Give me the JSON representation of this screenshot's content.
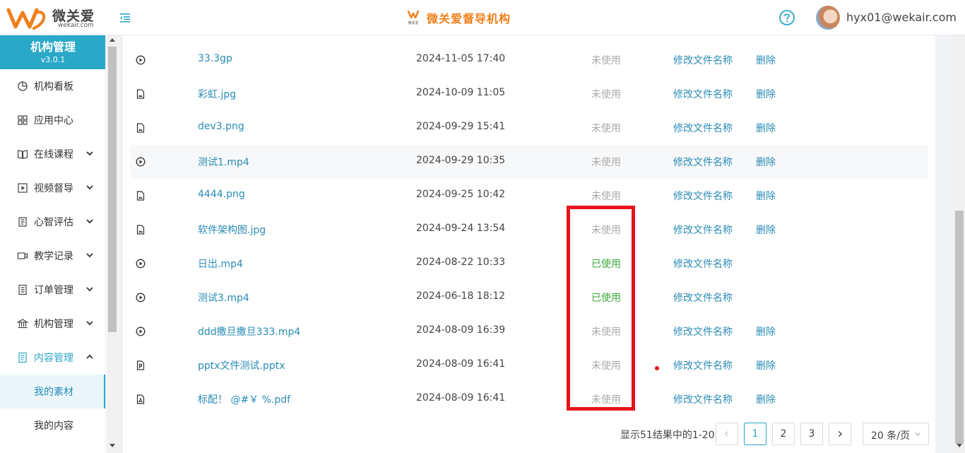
{
  "header": {
    "logo_cn": "微关爱",
    "logo_en": "wekair.com",
    "brand_icon_text": "微关爱",
    "brand_title": "微关爱督导机构",
    "user_email": "hyx01@wekair.com"
  },
  "sidebar": {
    "title": "机构管理",
    "version": "v3.0.1",
    "items": [
      {
        "label": "机构看板",
        "icon": "dashboard-icon"
      },
      {
        "label": "应用中心",
        "icon": "grid-icon"
      },
      {
        "label": "在线课程",
        "icon": "course-icon"
      },
      {
        "label": "视频督导",
        "icon": "video-icon"
      },
      {
        "label": "心智评估",
        "icon": "assessment-icon"
      },
      {
        "label": "教学记录",
        "icon": "camera-icon"
      },
      {
        "label": "订单管理",
        "icon": "order-icon"
      },
      {
        "label": "机构管理",
        "icon": "institution-icon"
      },
      {
        "label": "内容管理",
        "icon": "content-icon"
      }
    ],
    "sub_items": [
      {
        "label": "我的素材"
      },
      {
        "label": "我的内容"
      }
    ]
  },
  "table": {
    "rename_label": "修改文件名称",
    "delete_label": "删除",
    "rows": [
      {
        "type": "video",
        "name": "33.3gp",
        "date": "2024-11-05 17:40",
        "status": "未使用"
      },
      {
        "type": "image",
        "name": "彩虹.jpg",
        "date": "2024-10-09 11:05",
        "status": "未使用"
      },
      {
        "type": "image",
        "name": "dev3.png",
        "date": "2024-09-29 15:41",
        "status": "未使用"
      },
      {
        "type": "video",
        "name": "测试1.mp4",
        "date": "2024-09-29 10:35",
        "status": "未使用"
      },
      {
        "type": "image",
        "name": "4444.png",
        "date": "2024-09-25 10:42",
        "status": "未使用"
      },
      {
        "type": "image",
        "name": "软件架构图.jpg",
        "date": "2024-09-24 13:54",
        "status": "未使用"
      },
      {
        "type": "video",
        "name": "日出.mp4",
        "date": "2024-08-22 10:33",
        "status": "已使用"
      },
      {
        "type": "video",
        "name": "测试3.mp4",
        "date": "2024-06-18 18:12",
        "status": "已使用"
      },
      {
        "type": "video",
        "name": "ddd撒旦撒旦333.mp4",
        "date": "2024-08-09 16:39",
        "status": "未使用"
      },
      {
        "type": "ppt",
        "name": "pptx文件测试.pptx",
        "date": "2024-08-09 16:41",
        "status": "未使用"
      },
      {
        "type": "pdf",
        "name": "标配！ @#￥ %.pdf",
        "date": "2024-08-09 16:41",
        "status": "未使用"
      }
    ]
  },
  "pagination": {
    "total_text": "显示51结果中的1-20",
    "pages": [
      "1",
      "2",
      "3"
    ],
    "current": "1",
    "page_size": "20 条/页"
  },
  "colors": {
    "accent": "#2aa8c8",
    "link": "#2a8cb5",
    "brand_orange": "#ef7f1a",
    "used_green": "#3aa83a",
    "highlight_red": "#e6131b"
  }
}
